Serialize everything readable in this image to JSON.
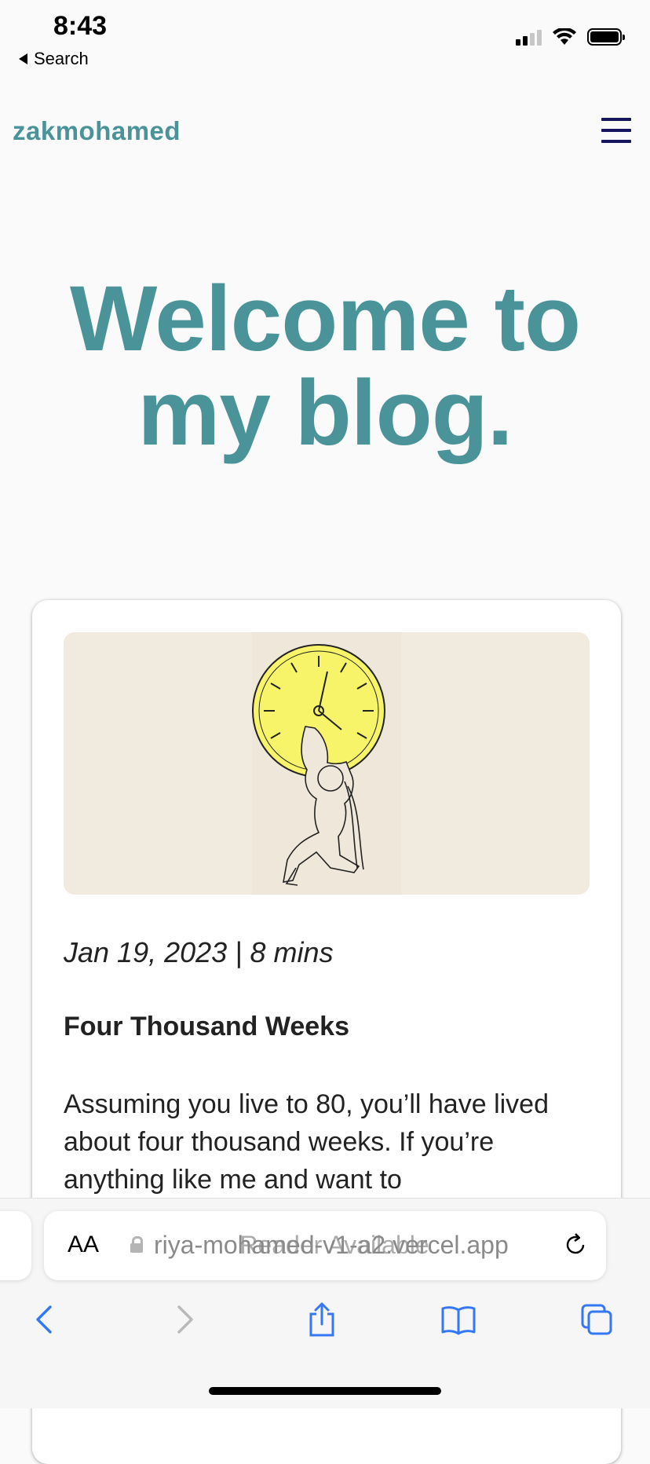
{
  "status_bar": {
    "time": "8:43",
    "back_label": "Search"
  },
  "site": {
    "brand": "zakmohamed",
    "menu_icon": "hamburger-menu-icon",
    "hero_line1": "Welcome to",
    "hero_line2": "my blog."
  },
  "post": {
    "image_alt": "kneeling-figure-holding-clock",
    "meta": "Jan 19, 2023 | 8 mins",
    "title": "Four Thousand Weeks",
    "excerpt": "Assuming you live to 80, you’ll have lived about four thousand weeks. If you’re anything like me and want to"
  },
  "browser": {
    "aa_label": "AA",
    "url": "riya-mohamed-v1-a2.vercel.app",
    "reader_label": "Reader Available",
    "icons": [
      "reload-icon",
      "back-icon",
      "forward-icon",
      "share-icon",
      "bookmarks-icon",
      "tabs-icon"
    ]
  },
  "colors": {
    "accent": "#4a9499",
    "menu": "#15155e",
    "image_bg": "#f1ebdf",
    "clock_face": "#f7f46a",
    "ios_blue": "#3478f6"
  }
}
